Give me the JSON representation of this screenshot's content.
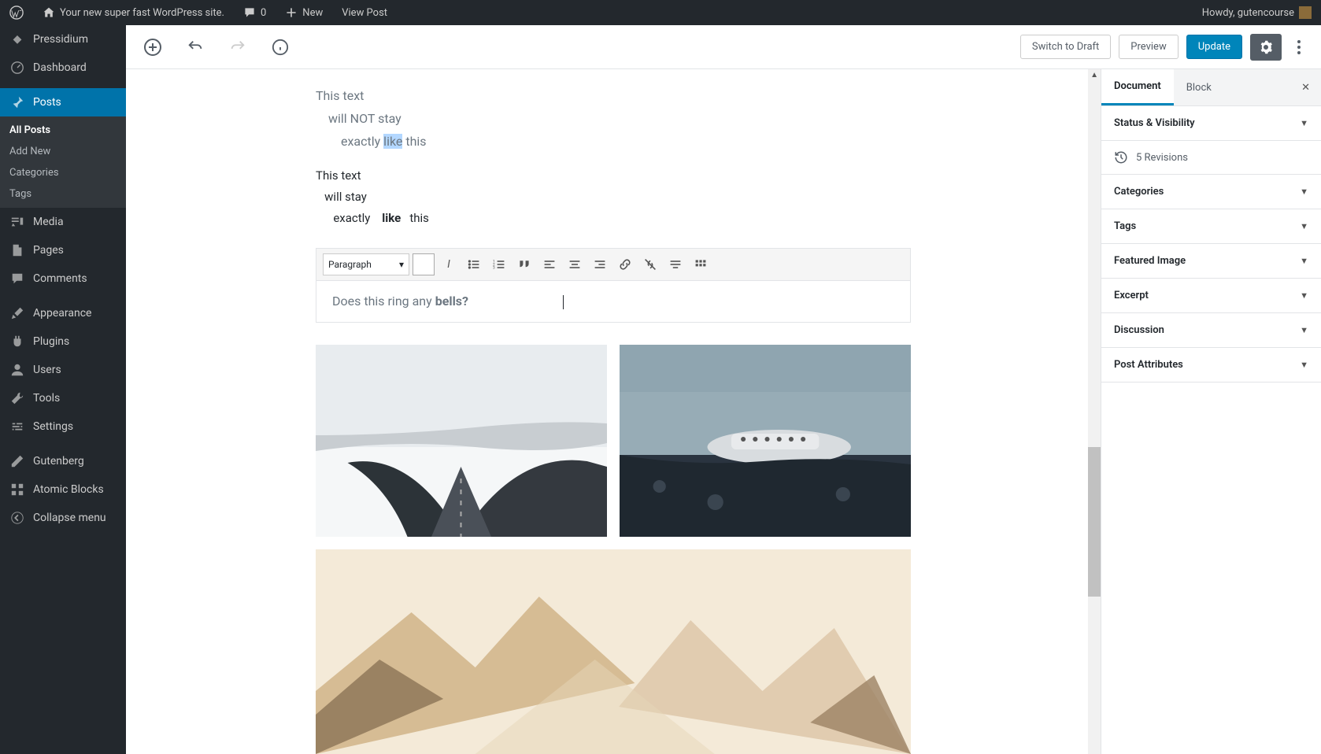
{
  "admin_bar": {
    "site_title": "Your new super fast WordPress site.",
    "comments_count": "0",
    "new_label": "New",
    "view_post": "View Post",
    "howdy": "Howdy, gutencourse"
  },
  "sidebar": {
    "items": [
      {
        "label": "Pressidium"
      },
      {
        "label": "Dashboard"
      },
      {
        "label": "Posts",
        "active": true,
        "sub": [
          {
            "label": "All Posts",
            "current": true
          },
          {
            "label": "Add New"
          },
          {
            "label": "Categories"
          },
          {
            "label": "Tags"
          }
        ]
      },
      {
        "label": "Media"
      },
      {
        "label": "Pages"
      },
      {
        "label": "Comments"
      },
      {
        "label": "Appearance"
      },
      {
        "label": "Plugins"
      },
      {
        "label": "Users"
      },
      {
        "label": "Tools"
      },
      {
        "label": "Settings"
      },
      {
        "label": "Gutenberg"
      },
      {
        "label": "Atomic Blocks"
      },
      {
        "label": "Collapse menu"
      }
    ]
  },
  "toolbar": {
    "draft": "Switch to Draft",
    "preview": "Preview",
    "update": "Update"
  },
  "content": {
    "verse": {
      "l1": "This text",
      "l2": "will NOT stay",
      "l3a": "exactly      ",
      "l3b": "like",
      "l3c": " this"
    },
    "pre": "This text\n   will stay\n      exactly    like   this",
    "classic": {
      "format_select": "Paragraph",
      "text_a": "Does this ring any ",
      "text_b": "bells?"
    }
  },
  "right_sidebar": {
    "tab_document": "Document",
    "tab_block": "Block",
    "panels": {
      "status": "Status & Visibility",
      "revisions_count": "5 Revisions",
      "categories": "Categories",
      "tags": "Tags",
      "featured": "Featured Image",
      "excerpt": "Excerpt",
      "discussion": "Discussion",
      "attributes": "Post Attributes"
    }
  }
}
